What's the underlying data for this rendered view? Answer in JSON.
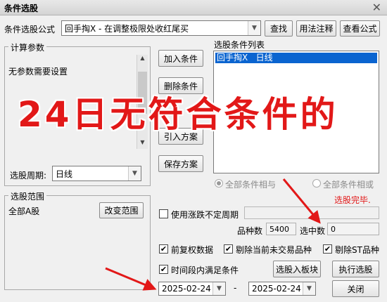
{
  "window": {
    "title": "条件选股",
    "close_glyph": "✕"
  },
  "formula": {
    "label": "条件选股公式",
    "value": "回手掏X  -  在调整极限处收红尾买",
    "buttons": {
      "find": "查找",
      "usage": "用法注释",
      "view": "查看公式"
    }
  },
  "params": {
    "group_label": "计算参数",
    "text": "无参数需要设置"
  },
  "actions": {
    "add": "加入条件",
    "delete": "删除条件",
    "import": "引入方案",
    "save": "保存方案"
  },
  "condition_list": {
    "label": "选股条件列表",
    "items": [
      "回手掏X   日线"
    ]
  },
  "period": {
    "label": "选股周期:",
    "value": "日线"
  },
  "logic": {
    "and_label": "全部条件相与",
    "or_label": "全部条件相或"
  },
  "status": {
    "text": "选股完毕.",
    "color": "#e21818"
  },
  "range": {
    "group_label": "选股范围",
    "value": "全部A股",
    "change_button": "改变范围"
  },
  "volatility": {
    "label": "使用涨跌不定周期"
  },
  "counts": {
    "total_label": "品种数",
    "total_value": "5400",
    "selected_label": "选中数",
    "selected_value": "0"
  },
  "options": {
    "fq": "前复权数据",
    "exclude_untraded": "剔除当前未交易品种",
    "exclude_st": "剔除ST品种",
    "period_all": "时间段内满足条件"
  },
  "date_range": {
    "start": "2025-02-24",
    "separator": "-",
    "end": "2025-02-24"
  },
  "bottom_buttons": {
    "to_block": "选股入板块",
    "run": "执行选股",
    "close": "关闭"
  },
  "overlay": {
    "text": "24日无符合条件的",
    "color": "#e21818"
  },
  "arrows": {
    "color": "#e21818"
  }
}
